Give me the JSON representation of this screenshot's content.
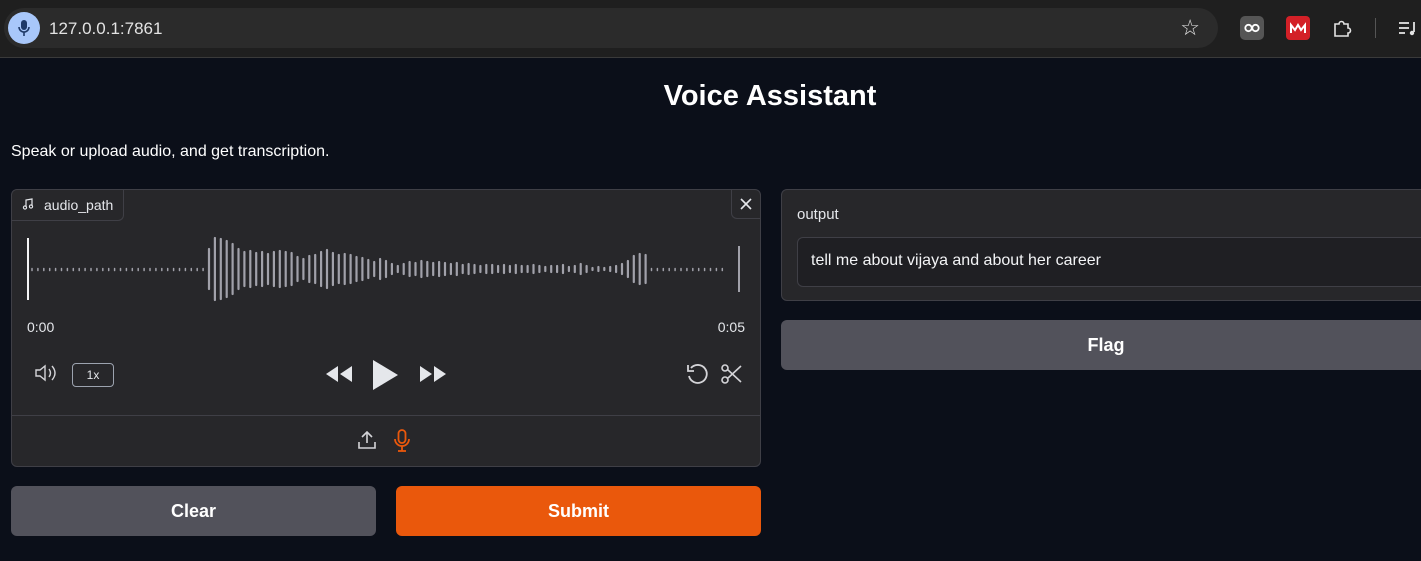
{
  "browser": {
    "url": "127.0.0.1:7861",
    "icons": [
      "mic-icon",
      "star-icon",
      "extension-infinity-icon",
      "extension-m-icon",
      "puzzle-icon",
      "media-queue-icon"
    ]
  },
  "page": {
    "title": "Voice Assistant",
    "description": "Speak or upload audio, and get transcription."
  },
  "audio": {
    "label": "audio_path",
    "time_start": "0:00",
    "time_end": "0:05",
    "playback_rate": "1x",
    "waveform_color": "#a1a1aa",
    "active_source_color": "#ea580c"
  },
  "output": {
    "label": "output",
    "value": "tell me about vijaya and about her career"
  },
  "buttons": {
    "clear": "Clear",
    "submit": "Submit",
    "flag": "Flag"
  },
  "colors": {
    "background": "#0b0f19",
    "panel": "#27272a",
    "primary": "#ea580c",
    "secondary": "#52525b"
  }
}
